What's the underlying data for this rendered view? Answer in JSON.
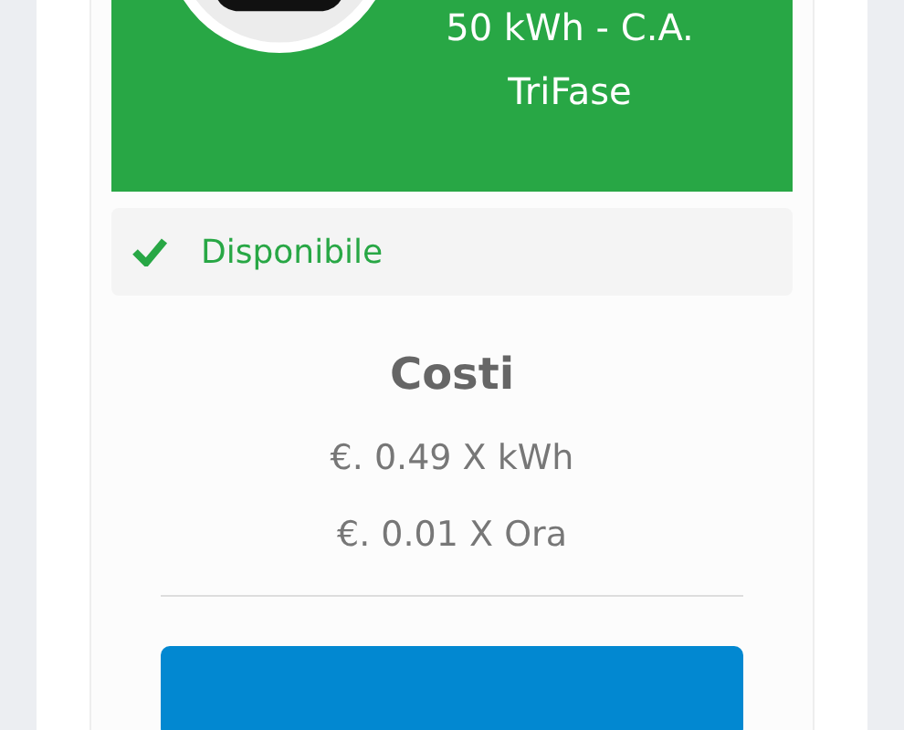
{
  "header": {
    "title": "50 kWh - C.A. TriFase"
  },
  "status": {
    "label": "Disponibile",
    "available": true
  },
  "costs": {
    "title": "Costi",
    "lines": [
      "€. 0.49 X kWh",
      "€. 0.01 X Ora"
    ]
  }
}
